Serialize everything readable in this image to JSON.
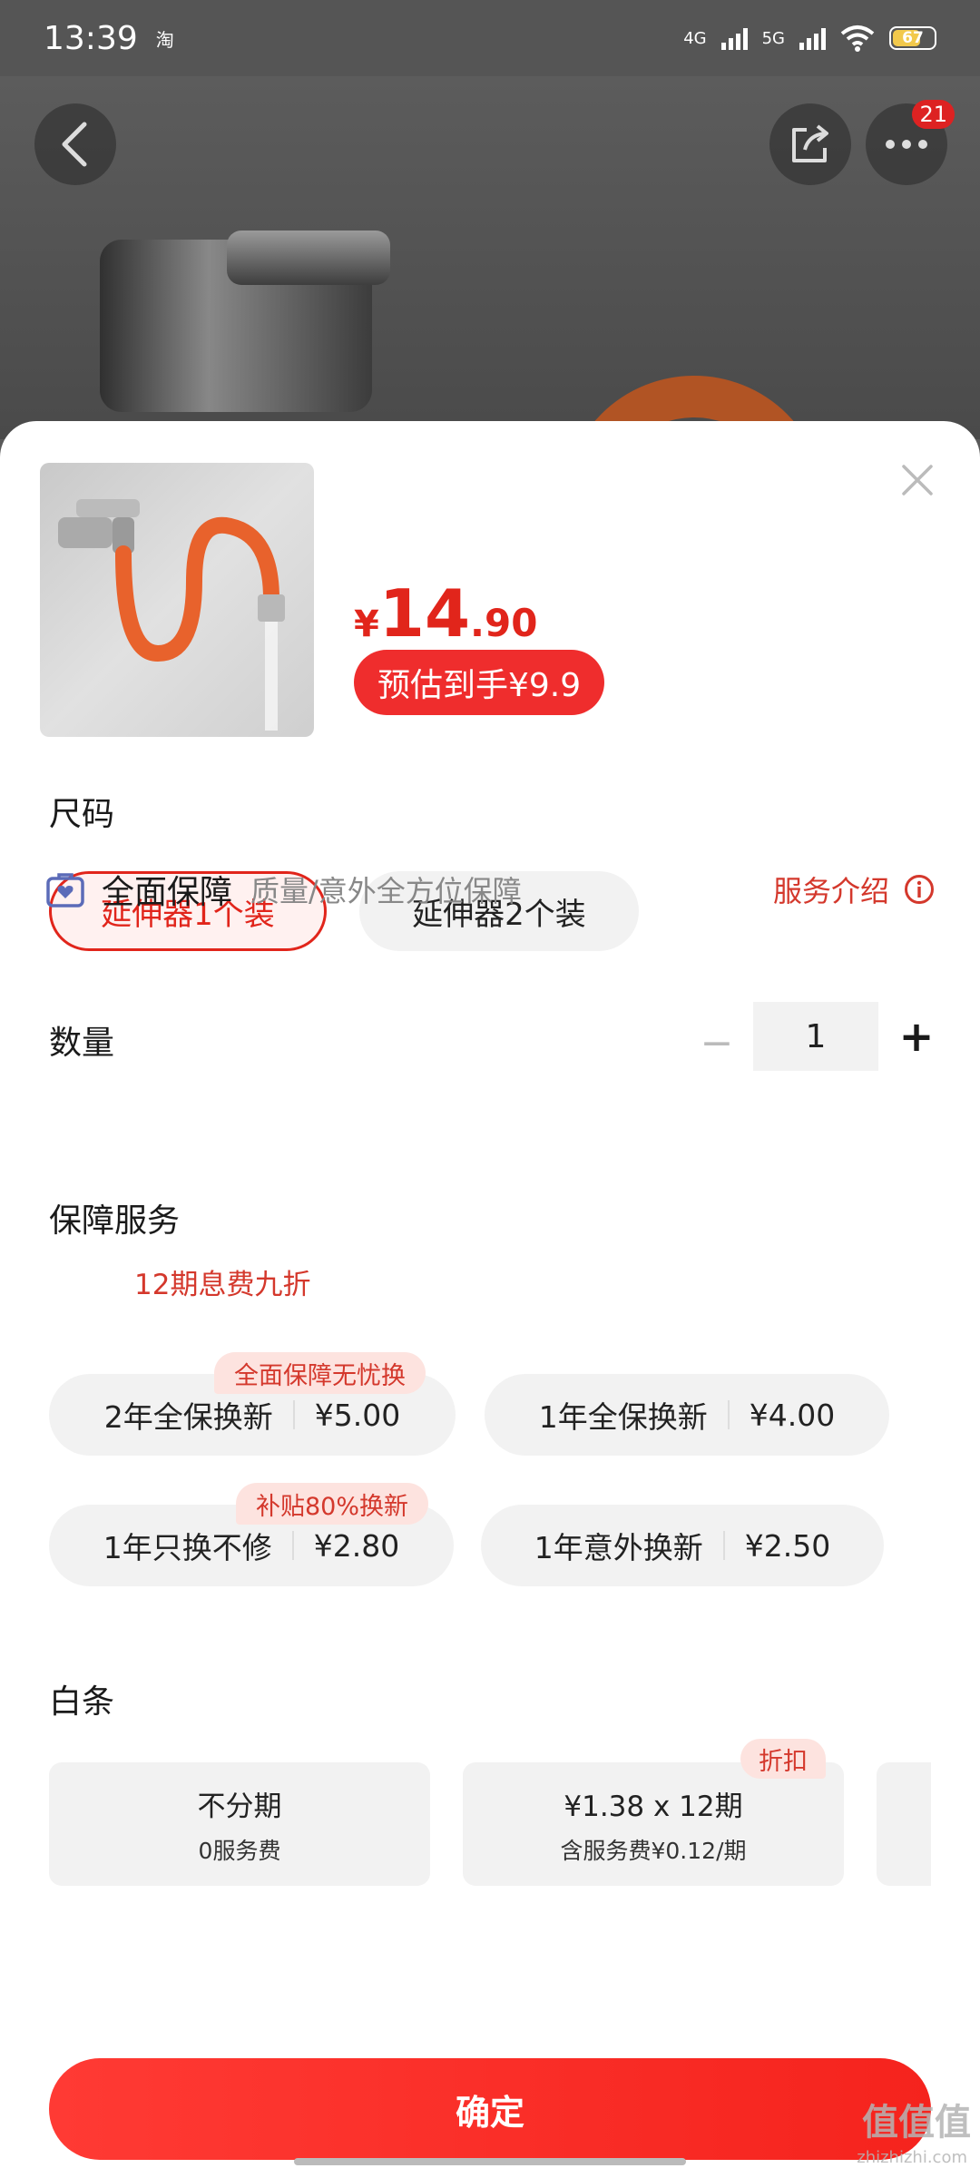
{
  "status_bar": {
    "time": "13:39",
    "app_icon": "淘",
    "net1": "4G",
    "net2": "5G",
    "battery": "67"
  },
  "header": {
    "more_badge": "21"
  },
  "product": {
    "price_symbol": "¥",
    "price_int": "14",
    "price_dec": ".90",
    "estimate_label": "预估到手¥9.9"
  },
  "size": {
    "title": "尺码",
    "options": [
      "延伸器1个装",
      "延伸器2个装"
    ],
    "selected_index": 0
  },
  "quantity": {
    "title": "数量",
    "minus": "−",
    "value": "1",
    "plus": "+"
  },
  "service": {
    "title": "保障服务",
    "name": "全面保障",
    "desc": "质量/意外全方位保障",
    "intro": "服务介绍",
    "options": [
      {
        "name": "2年全保换新",
        "price": "¥5.00",
        "tag": "全面保障无忧换"
      },
      {
        "name": "1年全保换新",
        "price": "¥4.00",
        "tag": ""
      },
      {
        "name": "1年只换不修",
        "price": "¥2.80",
        "tag": "补贴80%换新"
      },
      {
        "name": "1年意外换新",
        "price": "¥2.50",
        "tag": ""
      }
    ]
  },
  "baitiao": {
    "title": "白条",
    "subtitle": "12期息费九折",
    "plans": [
      {
        "line1": "不分期",
        "line2": "0服务费",
        "tag": ""
      },
      {
        "line1": "¥1.38 x 12期",
        "line2": "含服务费¥0.12/期",
        "tag": "折扣"
      }
    ]
  },
  "confirm_label": "确定",
  "watermark": {
    "text": "值值值",
    "sub": "zhizhizhi.com"
  },
  "colors": {
    "accent": "#e1251b",
    "chip_bg": "#f2f2f2",
    "tag_bg": "#fde3df"
  }
}
